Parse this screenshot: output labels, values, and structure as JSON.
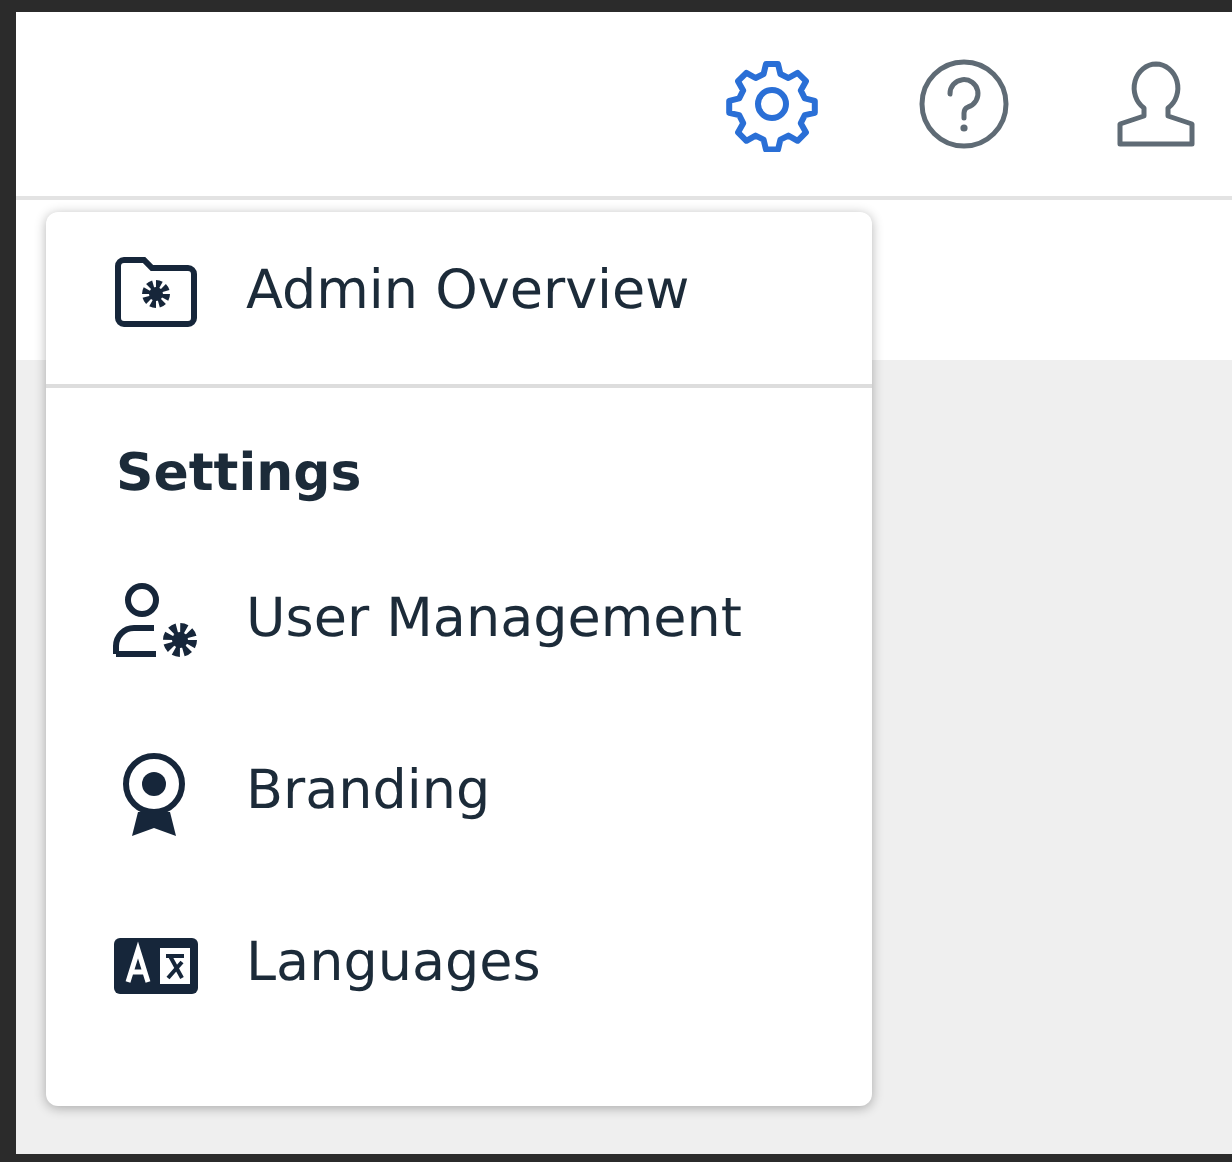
{
  "header_icons": [
    {
      "kind": "settings",
      "active": true
    },
    {
      "kind": "help",
      "active": false
    },
    {
      "kind": "user",
      "active": false
    }
  ],
  "menu": {
    "items": [
      {
        "kind": "link",
        "label": "Admin Overview"
      },
      {
        "kind": "divider"
      },
      {
        "kind": "heading",
        "label": "Settings"
      },
      {
        "kind": "link",
        "label": "User Management"
      },
      {
        "kind": "link",
        "label": "Branding"
      },
      {
        "kind": "link",
        "label": "Languages"
      }
    ]
  }
}
